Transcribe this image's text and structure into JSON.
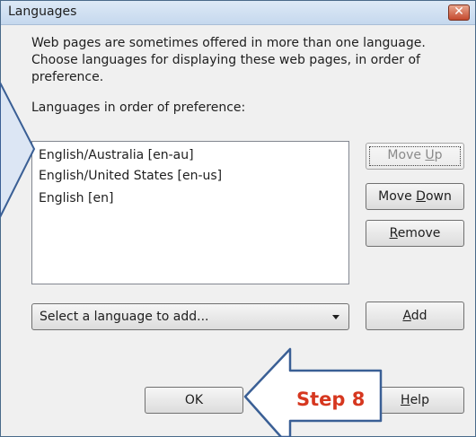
{
  "window": {
    "title": "Languages",
    "close_glyph": "✕"
  },
  "description": {
    "line1": "Web pages are sometimes offered in more than one language.",
    "line2": "Choose languages for displaying these web pages, in order of",
    "line3": "preference."
  },
  "list_label": "Languages in order of preference:",
  "languages": [
    {
      "label": "English/Australia  [en-au]"
    },
    {
      "label": "English/United States  [en-us]"
    },
    {
      "label": "English  [en]"
    }
  ],
  "buttons": {
    "move_up": {
      "pre": "Move ",
      "key": "U",
      "post": "p",
      "enabled": false
    },
    "move_down": {
      "pre": "Move ",
      "key": "D",
      "post": "own"
    },
    "remove": {
      "pre": "",
      "key": "R",
      "post": "emove"
    },
    "add": {
      "pre": "",
      "key": "A",
      "post": "dd"
    },
    "ok": "OK",
    "help": {
      "pre": "",
      "key": "H",
      "post": "elp"
    }
  },
  "select": {
    "value": "Select a language to add...",
    "icon": "dropdown-arrow-icon"
  },
  "annotation": {
    "step_label": "Step 8",
    "color": "#d6371f",
    "arrow_fill": "#dce6f4",
    "arrow_stroke": "#3a5f95"
  }
}
